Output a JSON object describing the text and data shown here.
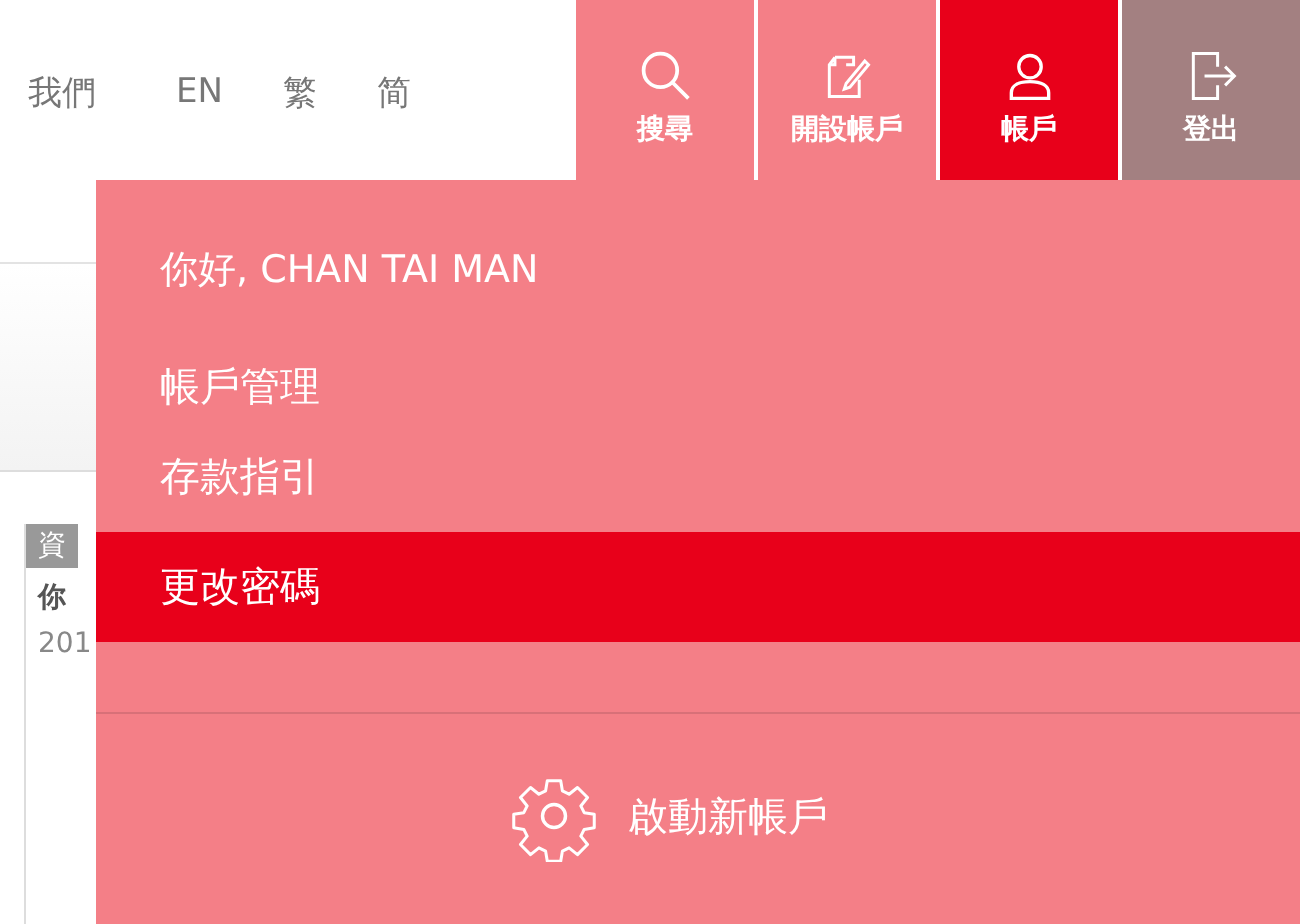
{
  "nav_links": [
    {
      "label": "我們"
    },
    {
      "label": "EN"
    },
    {
      "label": "繁"
    },
    {
      "label": "简"
    }
  ],
  "header_buttons": [
    {
      "label": "搜尋",
      "kind": "search",
      "selected": false
    },
    {
      "label": "開設帳戶",
      "kind": "apply",
      "selected": false
    },
    {
      "label": "帳戶",
      "kind": "account",
      "selected": true
    },
    {
      "label": "登出",
      "kind": "logout",
      "selected": false
    }
  ],
  "background": {
    "tab_label": "資",
    "item_title": "你",
    "item_date": "201"
  },
  "account_menu": {
    "greeting": "你好, CHAN TAI MAN",
    "items": [
      {
        "label": "帳戶管理",
        "selected": false
      },
      {
        "label": "存款指引",
        "selected": false
      },
      {
        "label": "更改密碼",
        "selected": true
      }
    ],
    "footer_action": {
      "label": "啟動新帳戶"
    }
  }
}
